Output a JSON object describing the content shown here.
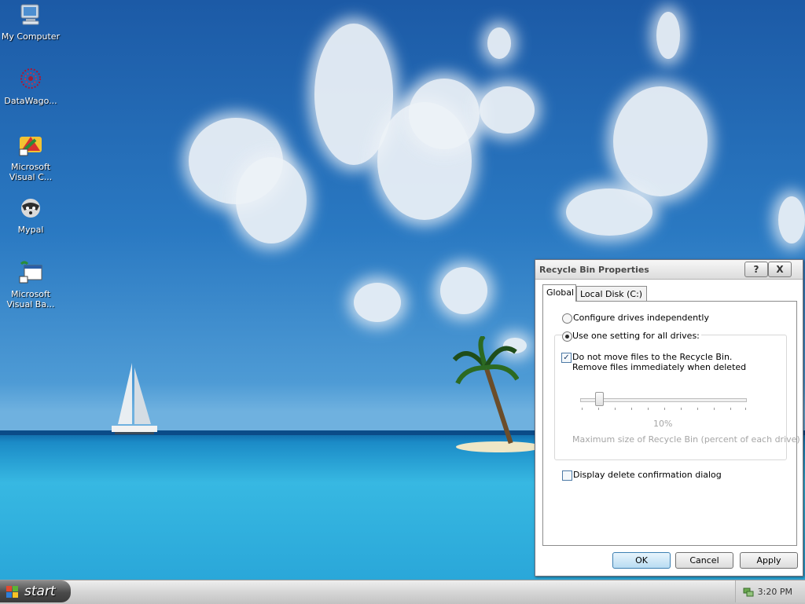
{
  "desktop": {
    "icons": [
      {
        "label": "My Computer",
        "icon": "my-computer-icon"
      },
      {
        "label": "DataWago...",
        "icon": "datawago-icon"
      },
      {
        "label": "Microsoft Visual C...",
        "icon": "visual-c-icon"
      },
      {
        "label": "Mypal",
        "icon": "mypal-icon"
      },
      {
        "label": "Microsoft Visual Ba...",
        "icon": "visual-basic-icon"
      }
    ]
  },
  "dialog": {
    "title": "Recycle Bin Properties",
    "help_button": "?",
    "close_button": "X",
    "tabs": [
      {
        "label": "Global",
        "active": true
      },
      {
        "label": "Local Disk (C:)",
        "active": false
      }
    ],
    "options": {
      "configure_independently": "Configure drives independently",
      "use_one_setting": "Use one setting for all drives:",
      "do_not_move": "Do not move files to the Recycle Bin.",
      "remove_immediately": "Remove files immediately when deleted",
      "slider_value": "10%",
      "slider_caption": "Maximum size of Recycle Bin (percent of each drive)",
      "display_confirmation": "Display delete confirmation dialog"
    },
    "state": {
      "configure_independently": false,
      "use_one_setting": true,
      "do_not_move_checked": true,
      "display_confirmation_checked": false,
      "max_size_percent": 10
    },
    "buttons": {
      "ok": "OK",
      "cancel": "Cancel",
      "apply": "Apply"
    }
  },
  "taskbar": {
    "start_label": "start",
    "clock": "3:20 PM",
    "tray_icon": "network-tray-icon"
  }
}
